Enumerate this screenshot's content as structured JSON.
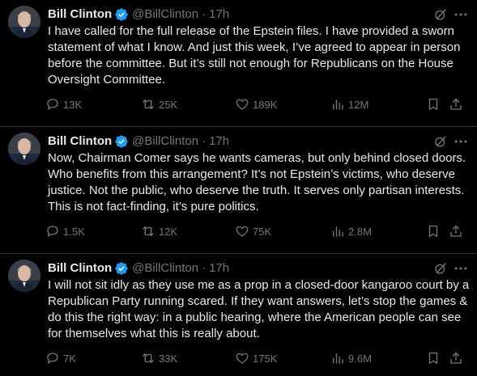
{
  "colors": {
    "background": "#000000",
    "text": "#e7e9ea",
    "muted": "#71767b",
    "verified": "#1d9bf0",
    "divider": "#2f3336"
  },
  "tweets": [
    {
      "author": {
        "name": "Bill Clinton",
        "handle": "@BillClinton",
        "time": "17h",
        "verified_icon": "verified-badge-icon"
      },
      "text": "I have called for the full release of the Epstein files. I have provided a sworn statement of what I know. And just this week, I’ve agreed to appear in person before the committee. But it’s still not enough for Republicans on the House Oversight Committee.",
      "stats": {
        "replies": "13K",
        "reposts": "25K",
        "likes": "189K",
        "views": "12M"
      }
    },
    {
      "author": {
        "name": "Bill Clinton",
        "handle": "@BillClinton",
        "time": "17h",
        "verified_icon": "verified-badge-icon"
      },
      "text": "Now, Chairman Comer says he wants cameras, but only behind closed doors. Who benefits from this arrangement? It’s not Epstein’s victims, who deserve justice. Not the public, who deserve the truth. It serves only partisan interests. This is not fact-finding, it’s pure politics.",
      "stats": {
        "replies": "1.5K",
        "reposts": "12K",
        "likes": "75K",
        "views": "2.8M"
      }
    },
    {
      "author": {
        "name": "Bill Clinton",
        "handle": "@BillClinton",
        "time": "17h",
        "verified_icon": "verified-badge-icon"
      },
      "text": "I will not sit idly as they use me as a prop in a closed-door kangaroo court by a Republican Party running scared. If they want answers, let’s stop the games & do this the right way: in a public hearing, where the American people can see for themselves what this is really about.",
      "stats": {
        "replies": "7K",
        "reposts": "33K",
        "likes": "175K",
        "views": "9.6M"
      }
    }
  ]
}
